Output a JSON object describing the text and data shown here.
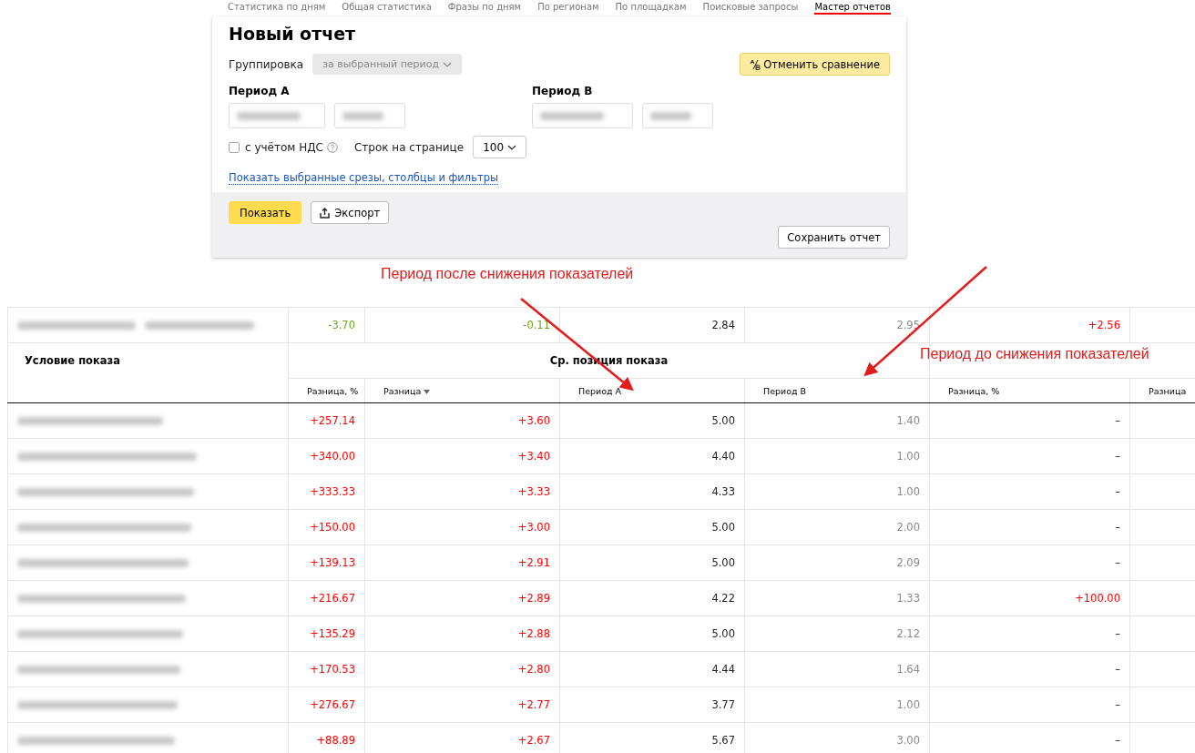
{
  "tabs": [
    {
      "label": "Статистика по дням",
      "selected": false
    },
    {
      "label": "Общая статистика",
      "selected": false
    },
    {
      "label": "Фразы по дням",
      "selected": false
    },
    {
      "label": "По регионам",
      "selected": false
    },
    {
      "label": "По площадкам",
      "selected": false
    },
    {
      "label": "Поисковые запросы",
      "selected": false
    },
    {
      "label": "Мастер отчетов",
      "selected": true
    }
  ],
  "report": {
    "title": "Новый отчет",
    "grouping_label": "Группировка",
    "grouping": {
      "value": "за выбранный период",
      "disabled": true
    },
    "compare_button": "Отменить сравнение",
    "period_a": "Период A",
    "period_b": "Период B",
    "vat": {
      "label": "с учётом НДС",
      "checked": false
    },
    "rows_label": "Строк на странице",
    "rows_value": "100",
    "link": "Показать выбранные срезы, столбцы и фильтры",
    "show_button": "Показать",
    "export_button": "Экспорт",
    "save_button": "Сохранить отчет"
  },
  "annotations": [
    {
      "text": "Период после снижения показателей"
    },
    {
      "text": "Период до снижения показателей"
    }
  ],
  "table": {
    "summary": [
      {
        "text": "-3.70",
        "color": "#6aa51a"
      },
      {
        "text": "-0.11",
        "color": "#6aa51a"
      },
      {
        "text": "2.84"
      },
      {
        "text": "2.95"
      },
      {
        "text": "+2.56",
        "color": "#ff0000"
      }
    ],
    "condition_header": "Условие показа",
    "group_header": "Ср. позиция показа",
    "columns": [
      {
        "label": "Разница, %",
        "sorted": false
      },
      {
        "label": "Разница",
        "sorted": true
      },
      {
        "label": "Период A",
        "sorted": false
      },
      {
        "label": "Период B",
        "sorted": false
      },
      {
        "label": "Разница, %",
        "sorted": false
      },
      {
        "label": "Разница",
        "sorted": false
      }
    ],
    "rows": [
      [
        {
          "text": "+257.14",
          "color": "#ff0000"
        },
        {
          "text": "+3.60",
          "color": "#ff0000"
        },
        {
          "text": "5.00"
        },
        {
          "text": "1.40"
        },
        {
          "text": "–"
        }
      ],
      [
        {
          "text": "+340.00",
          "color": "#ff0000"
        },
        {
          "text": "+3.40",
          "color": "#ff0000"
        },
        {
          "text": "4.40"
        },
        {
          "text": "1.00"
        },
        {
          "text": "–"
        }
      ],
      [
        {
          "text": "+333.33",
          "color": "#ff0000"
        },
        {
          "text": "+3.33",
          "color": "#ff0000"
        },
        {
          "text": "4.33"
        },
        {
          "text": "1.00"
        },
        {
          "text": "–"
        }
      ],
      [
        {
          "text": "+150.00",
          "color": "#ff0000"
        },
        {
          "text": "+3.00",
          "color": "#ff0000"
        },
        {
          "text": "5.00"
        },
        {
          "text": "2.00"
        },
        {
          "text": "–"
        }
      ],
      [
        {
          "text": "+139.13",
          "color": "#ff0000"
        },
        {
          "text": "+2.91",
          "color": "#ff0000"
        },
        {
          "text": "5.00"
        },
        {
          "text": "2.09"
        },
        {
          "text": "–"
        }
      ],
      [
        {
          "text": "+216.67",
          "color": "#ff0000"
        },
        {
          "text": "+2.89",
          "color": "#ff0000"
        },
        {
          "text": "4.22"
        },
        {
          "text": "1.33"
        },
        {
          "text": "+100.00",
          "color": "#ff0000"
        }
      ],
      [
        {
          "text": "+135.29",
          "color": "#ff0000"
        },
        {
          "text": "+2.88",
          "color": "#ff0000"
        },
        {
          "text": "5.00"
        },
        {
          "text": "2.12"
        },
        {
          "text": "–"
        }
      ],
      [
        {
          "text": "+170.53",
          "color": "#ff0000"
        },
        {
          "text": "+2.80",
          "color": "#ff0000"
        },
        {
          "text": "4.44"
        },
        {
          "text": "1.64"
        },
        {
          "text": "–"
        }
      ],
      [
        {
          "text": "+276.67",
          "color": "#ff0000"
        },
        {
          "text": "+2.77",
          "color": "#ff0000"
        },
        {
          "text": "3.77"
        },
        {
          "text": "1.00"
        },
        {
          "text": "–"
        }
      ],
      [
        {
          "text": "+88.89",
          "color": "#ff0000"
        },
        {
          "text": "+2.67",
          "color": "#ff0000"
        },
        {
          "text": "5.67"
        },
        {
          "text": "3.00"
        },
        {
          "text": "–"
        }
      ]
    ]
  }
}
